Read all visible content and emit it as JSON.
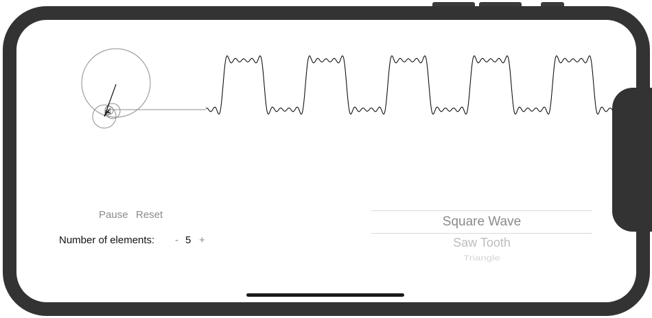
{
  "controls": {
    "pause_label": "Pause",
    "reset_label": "Reset"
  },
  "elements": {
    "label": "Number of elements:",
    "minus": "-",
    "count": "5",
    "plus": "+"
  },
  "wave_picker": {
    "options": [
      "Square Wave",
      "Saw Tooth",
      "Triangle"
    ],
    "selected": "Square Wave"
  },
  "visualization": {
    "wave_type": "square",
    "harmonics": 5
  },
  "colors": {
    "frame": "#333333",
    "wave_line": "#111111",
    "circle_stroke": "#8c8c8c",
    "button_text": "#8a8a8e"
  }
}
